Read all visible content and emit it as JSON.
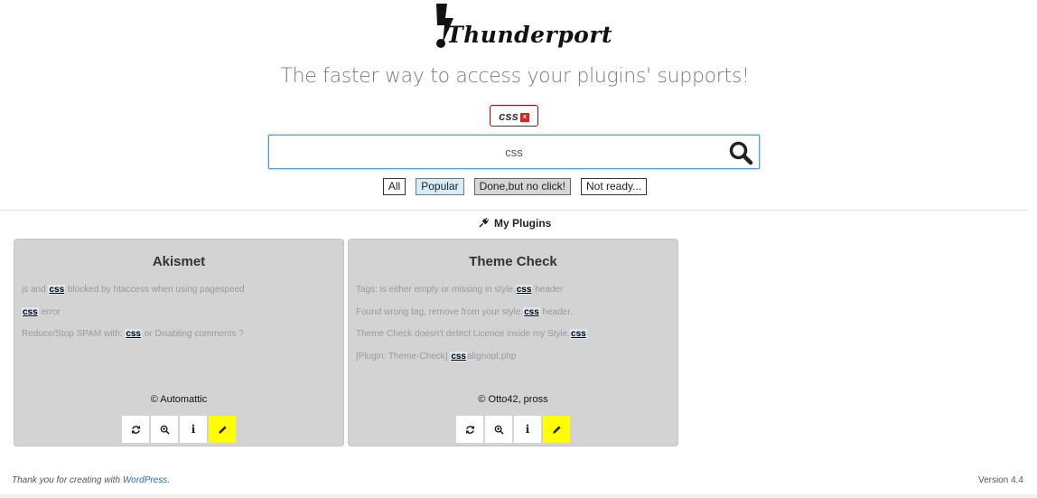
{
  "logo": {
    "text": "Thunderport"
  },
  "tagline": "The faster way to access your plugins' supports!",
  "active_tag": {
    "label": "css"
  },
  "search": {
    "value": "css"
  },
  "filters": [
    "All",
    "Popular",
    "Done,but no click!",
    "Not ready..."
  ],
  "section_title": "My Plugins",
  "cards": [
    {
      "title": "Akismet",
      "topics": [
        {
          "before": "js and ",
          "match": "css",
          "after": " blocked by htaccess when using pagespeed"
        },
        {
          "before": "",
          "match": "css",
          "after": " error"
        },
        {
          "before": "Reduce/Stop SPAM with: ",
          "match": "css",
          "after": " or Disabling comments ?"
        }
      ],
      "author": "© Automattic"
    },
    {
      "title": "Theme Check",
      "topics": [
        {
          "before": "Tags: is either empty or missing in style.",
          "match": "css",
          "after": " header"
        },
        {
          "before": "Found wrong tag, remove from your style.",
          "match": "css",
          "after": " header."
        },
        {
          "before": "Theme Check doesn't detect Licence inside my Style.",
          "match": "css",
          "after": ""
        },
        {
          "before": "[Plugin: Theme-Check] ",
          "match": "css",
          "after": "alignopt.php"
        }
      ],
      "author": "© Otto42, pross"
    }
  ],
  "action_icons": [
    "refresh-icon",
    "zoom-in-icon",
    "info-icon",
    "pencil-icon"
  ],
  "footer": {
    "thanks_prefix": "Thank you for creating with ",
    "thanks_link": "WordPress",
    "thanks_suffix": ".",
    "version": "Version 4.4"
  },
  "colors": {
    "accent_link": "#2271b1",
    "search_border": "#5b9dd9",
    "highlight": "#dbe8f4",
    "edit_button": "#ffff00",
    "card_bg": "#d3d3d3",
    "tag_border": "#bb0000"
  }
}
